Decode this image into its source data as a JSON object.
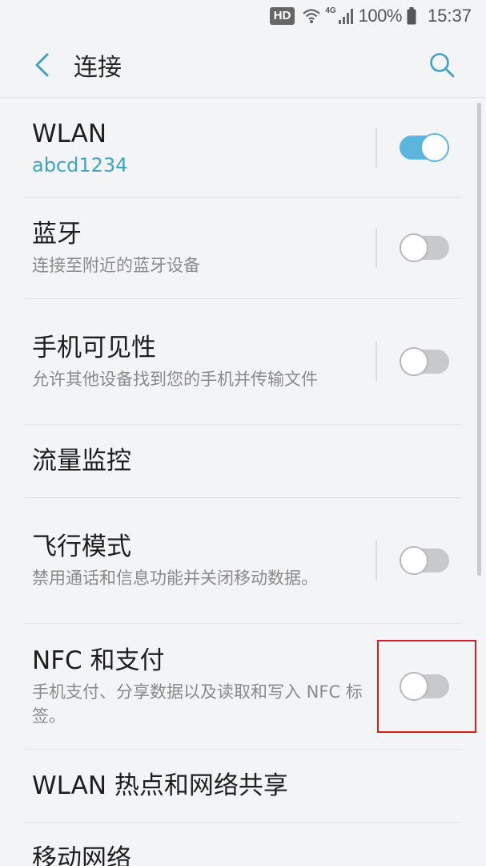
{
  "status_bar": {
    "hd": "HD",
    "network": "4G",
    "battery": "100%",
    "time": "15:37"
  },
  "header": {
    "title": "连接"
  },
  "items": [
    {
      "title": "WLAN",
      "subtitle": "abcd1234",
      "toggle": true
    },
    {
      "title": "蓝牙",
      "subtitle": "连接至附近的蓝牙设备",
      "toggle": false
    },
    {
      "title": "手机可见性",
      "subtitle": "允许其他设备找到您的手机并传输文件",
      "toggle": false
    },
    {
      "title": "流量监控"
    },
    {
      "title": "飞行模式",
      "subtitle": "禁用通话和信息功能并关闭移动数据。",
      "toggle": false
    },
    {
      "title": "NFC 和支付",
      "subtitle": "手机支付、分享数据以及读取和写入 NFC 标签。",
      "toggle": false
    },
    {
      "title": "WLAN 热点和网络共享"
    },
    {
      "title": "移动网络"
    }
  ],
  "colors": {
    "accent": "#3fa3c1",
    "toggle_on": "#5ab6dd",
    "toggle_off": "#c8c9cc",
    "highlight": "#d32020"
  }
}
